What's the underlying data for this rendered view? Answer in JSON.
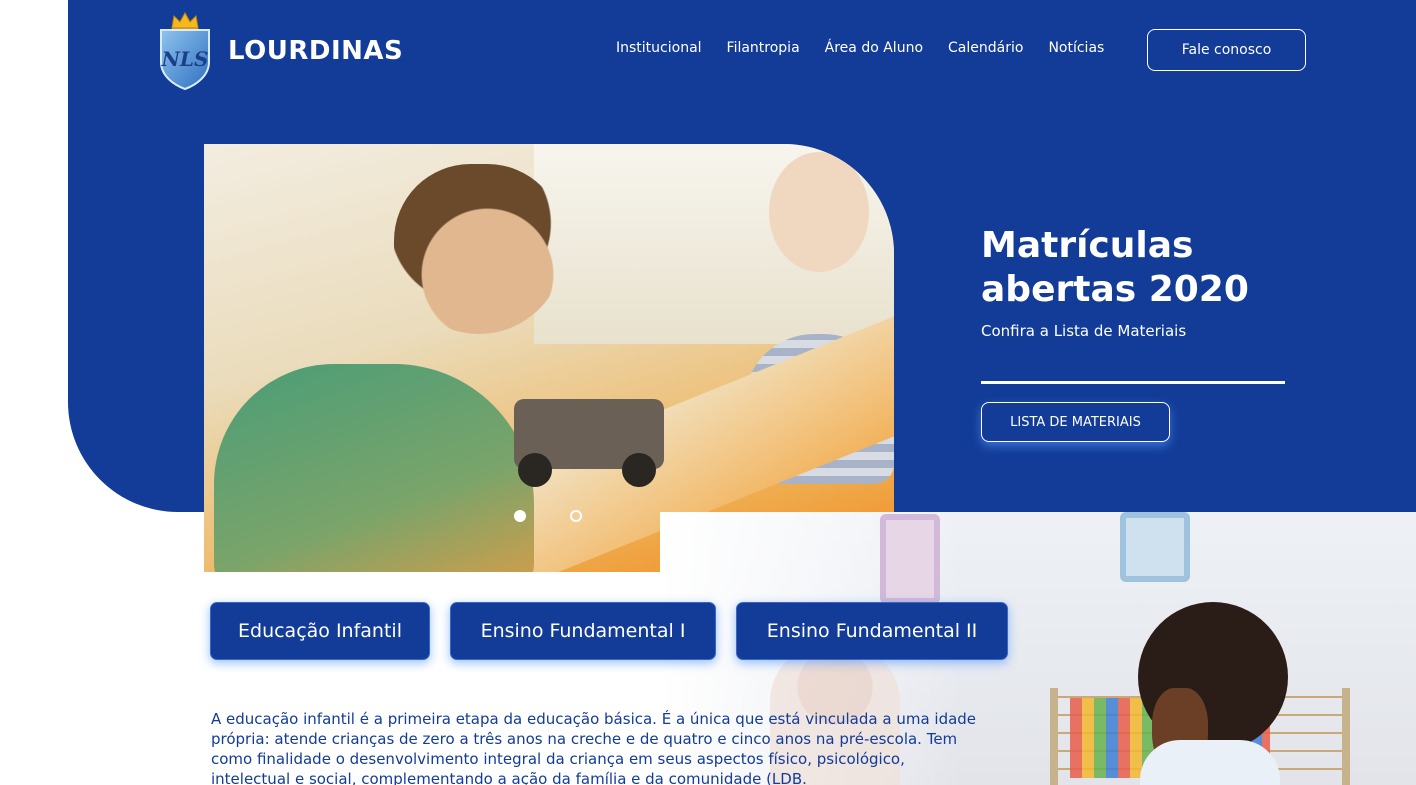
{
  "header": {
    "brand": "LOURDINAS",
    "crest_letters": "NLS",
    "nav": [
      "Institucional",
      "Filantropia",
      "Área do Aluno",
      "Calendário",
      "Notícias"
    ],
    "contact_label": "Fale conosco"
  },
  "hero": {
    "title": "Matrículas abertas 2020",
    "subtitle": "Confira a Lista de Materiais",
    "button_label": "LISTA DE MATERIAIS",
    "slide_count": 2,
    "active_slide": 1
  },
  "levels": [
    "Educação Infantil",
    "Ensino Fundamental I",
    "Ensino Fundamental II"
  ],
  "description": "A educação infantil é a primeira etapa da educação básica. É a única que está vinculada a uma idade própria: atende crianças de zero a três anos na creche e de quatro e cinco anos na pré-escola. Tem como finalidade o desenvolvimento integral da criança em seus aspectos físico, psicológico, intelectual e social, complementando a ação da família e da comunidade (LDB.",
  "colors": {
    "primary_blue": "#123c98",
    "white": "#ffffff",
    "crown_gold": "#f5b820"
  }
}
